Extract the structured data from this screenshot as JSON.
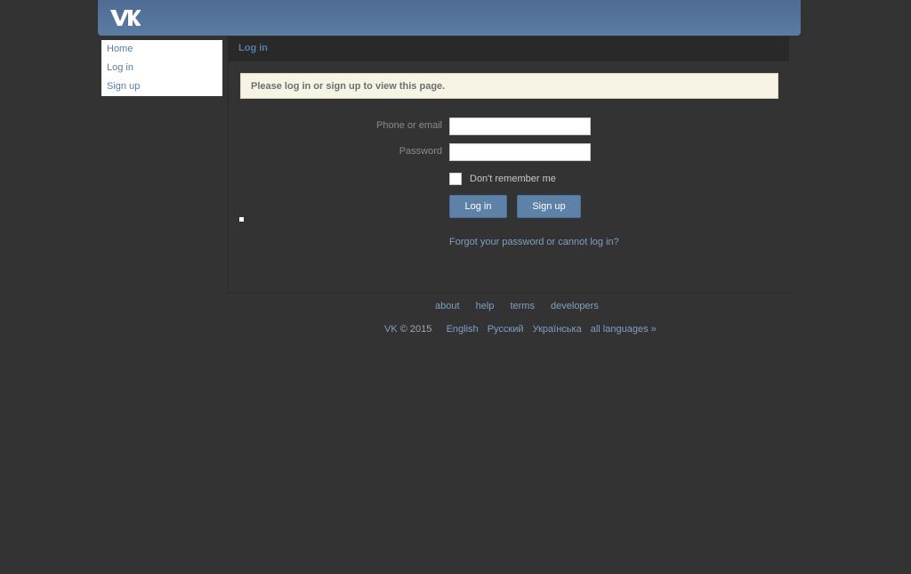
{
  "sidebar": {
    "items": [
      {
        "label": "Home"
      },
      {
        "label": "Log in"
      },
      {
        "label": "Sign up"
      }
    ]
  },
  "content": {
    "title": "Log in",
    "notice": "Please log in or sign up to view this page."
  },
  "form": {
    "login_label": "Phone or email",
    "login_value": "",
    "password_label": "Password",
    "password_value": "",
    "remember_label": "Don't remember me",
    "login_button": "Log in",
    "signup_button": "Sign up",
    "forgot_link": "Forgot your password or cannot log in?"
  },
  "footer": {
    "links": [
      "about",
      "help",
      "terms",
      "developers"
    ],
    "brand": "VK",
    "copyright": "© 2015",
    "languages": [
      "English",
      "Русский",
      "Українська",
      "all languages »"
    ]
  },
  "colors": {
    "header": "#5b7ca4",
    "background": "#333333",
    "link": "#7f9fc3",
    "notice_bg": "#f7f4e6",
    "button": "#5e81a8"
  },
  "icons": {
    "logo": "vk-logo-icon"
  }
}
